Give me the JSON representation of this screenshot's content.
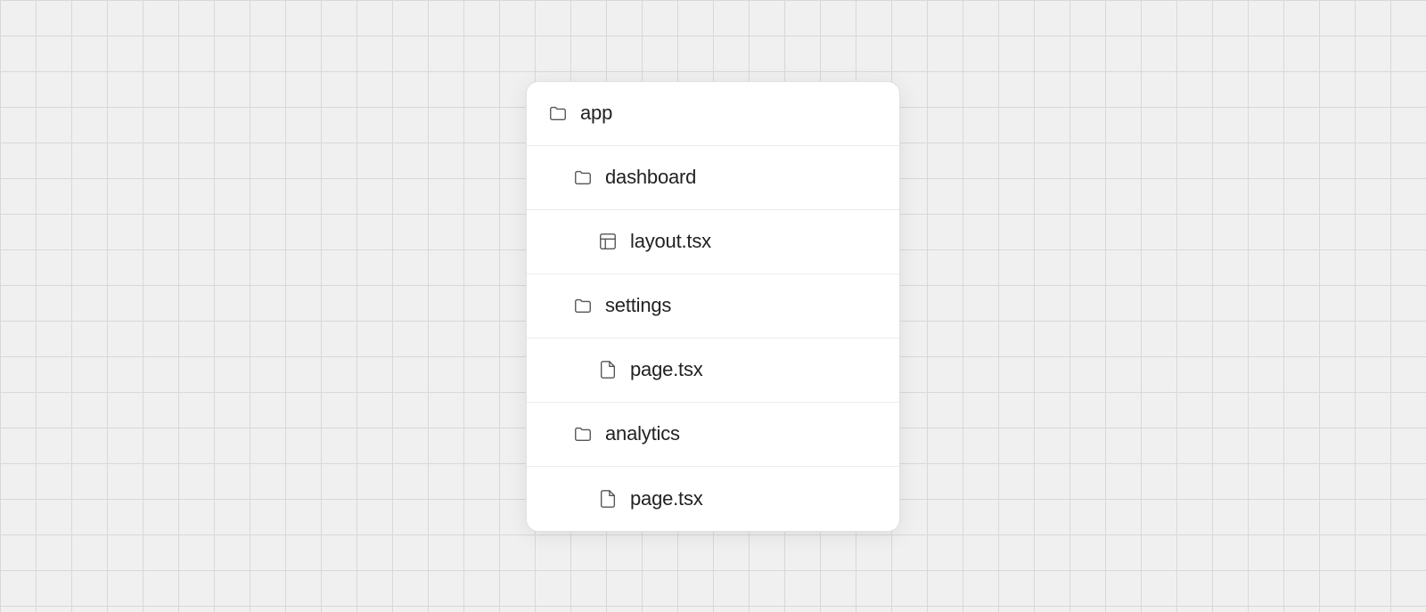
{
  "tree": {
    "items": [
      {
        "id": "app",
        "label": "app",
        "icon": "folder",
        "indent": 0
      },
      {
        "id": "dashboard",
        "label": "dashboard",
        "icon": "folder",
        "indent": 1
      },
      {
        "id": "layout-tsx",
        "label": "layout.tsx",
        "icon": "layout-file",
        "indent": 2
      },
      {
        "id": "settings",
        "label": "settings",
        "icon": "folder",
        "indent": 1
      },
      {
        "id": "page-tsx-1",
        "label": "page.tsx",
        "icon": "file",
        "indent": 2
      },
      {
        "id": "analytics",
        "label": "analytics",
        "icon": "folder",
        "indent": 1
      },
      {
        "id": "page-tsx-2",
        "label": "page.tsx",
        "icon": "file",
        "indent": 2
      }
    ]
  }
}
